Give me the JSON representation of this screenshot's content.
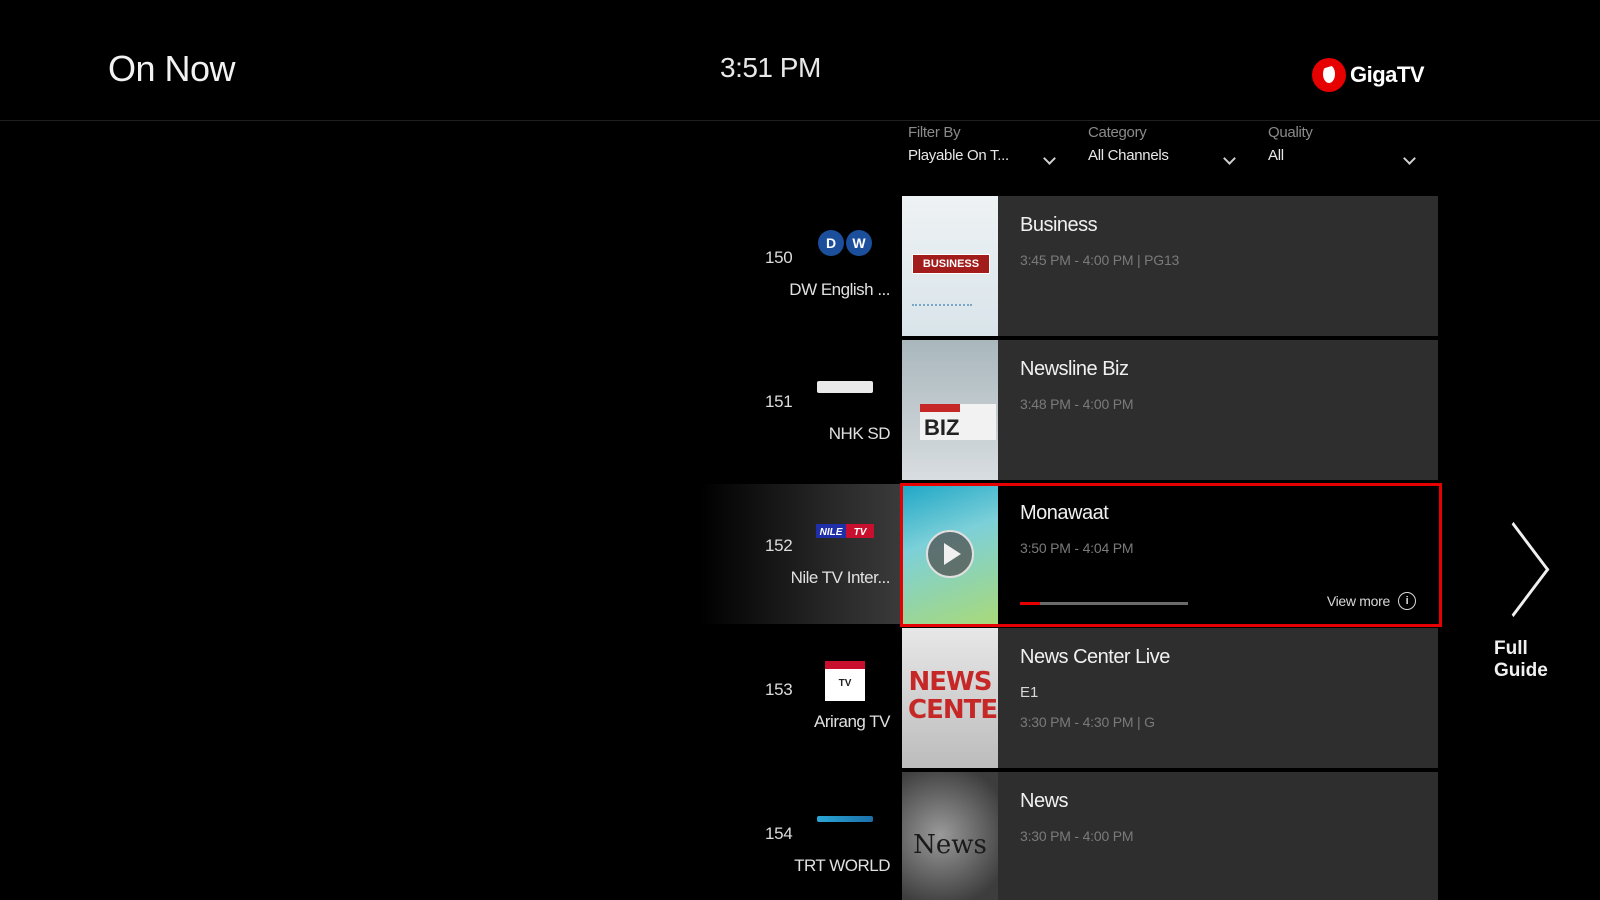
{
  "header": {
    "title": "On Now",
    "time": "3:51 PM",
    "brand": "GigaTV"
  },
  "filters": [
    {
      "label": "Filter By",
      "value": "Playable On T..."
    },
    {
      "label": "Category",
      "value": "All Channels"
    },
    {
      "label": "Quality",
      "value": "All"
    }
  ],
  "channels": [
    {
      "number": "150",
      "name": "DW English ...",
      "logo_text": "DW",
      "program": {
        "title": "Business",
        "time": "3:45 PM - 4:00 PM | PG13"
      },
      "thumb_text": "BUSINESS"
    },
    {
      "number": "151",
      "name": "NHK SD",
      "logo_text": "NHK WORLD",
      "program": {
        "title": "Newsline Biz",
        "time": "3:48 PM - 4:00 PM"
      },
      "thumb_text": "BIZ"
    },
    {
      "number": "152",
      "name": "Nile TV Inter...",
      "logo_text": "NILE TV",
      "program": {
        "title": "Monawaat",
        "time": "3:50 PM - 4:04 PM",
        "progress": 0.12,
        "view_more": "View more"
      }
    },
    {
      "number": "153",
      "name": "Arirang TV",
      "logo_text": "TV",
      "program": {
        "title": "News Center Live",
        "episode": "E1",
        "time": "3:30 PM - 4:30 PM | G"
      },
      "thumb_text": "NEWS CENTER"
    },
    {
      "number": "154",
      "name": "TRT WORLD",
      "logo_text": "TRT WORLD",
      "program": {
        "title": "News",
        "time": "3:30 PM - 4:00 PM"
      },
      "thumb_text": "News"
    }
  ],
  "full_guide": {
    "label": "Full Guide"
  },
  "colors": {
    "accent": "#e60000",
    "card": "#2e2e2e",
    "background": "#000000"
  }
}
